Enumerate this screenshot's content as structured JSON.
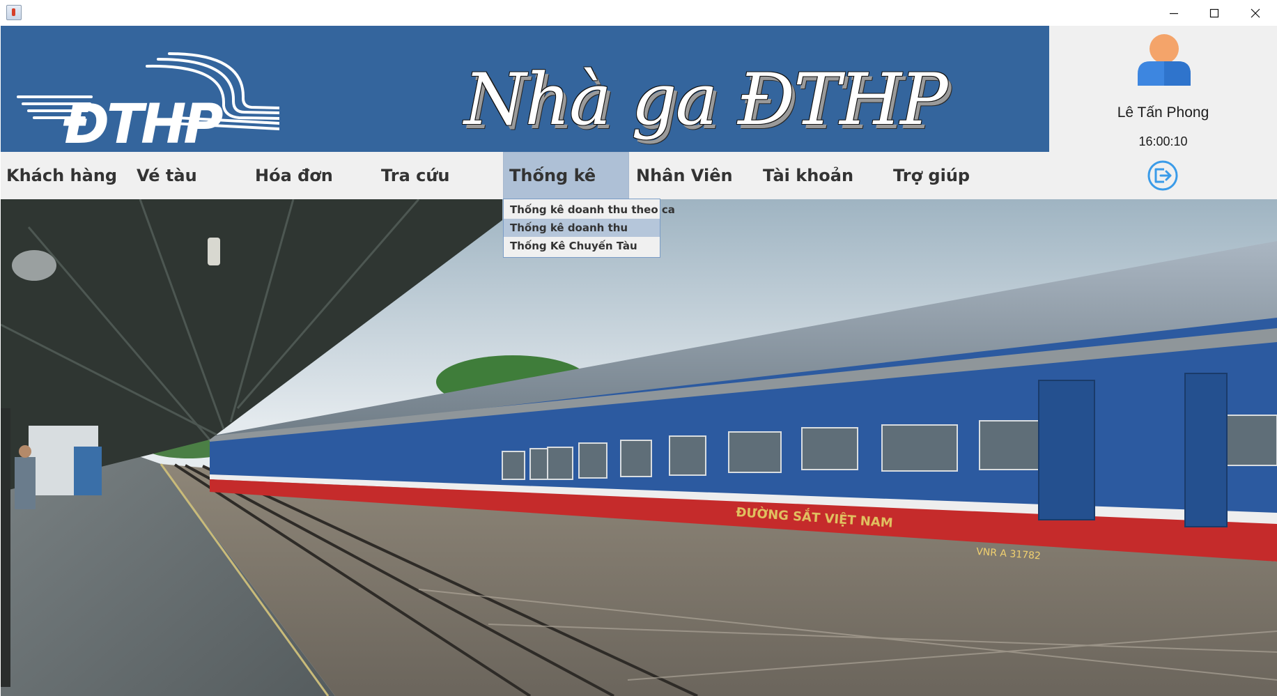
{
  "window": {
    "icon": "java-app-icon",
    "controls": [
      "minimize-icon",
      "maximize-icon",
      "close-icon"
    ]
  },
  "header": {
    "logo_text": "ĐTHP",
    "title": "Nhà ga ĐTHP",
    "background_color": "#34659d"
  },
  "user": {
    "avatar_icon": "user-avatar-icon",
    "name": "Lê Tấn Phong",
    "time": "16:00:10",
    "logout_icon": "logout-icon"
  },
  "menu": {
    "items": [
      {
        "label": "Khách hàng"
      },
      {
        "label": "Vé tàu"
      },
      {
        "label": "Hóa đơn"
      },
      {
        "label": "Tra cứu"
      },
      {
        "label": "Thống kê",
        "active": true
      },
      {
        "label": "Nhân Viên"
      },
      {
        "label": "Tài khoản"
      },
      {
        "label": "Trợ giúp"
      }
    ],
    "active_color": "#aec0d6"
  },
  "dropdown": {
    "parent": "Thống kê",
    "items": [
      {
        "label": "Thống kê doanh thu theo ca"
      },
      {
        "label": "Thống kê doanh thu",
        "hovered": true
      },
      {
        "label": "Thống Kê Chuyến Tàu"
      }
    ]
  },
  "background_image": {
    "subject": "train-station-photo",
    "car_marking": "ĐƯỜNG SẮT VIỆT NAM",
    "car_number": "VNR A 31782"
  }
}
